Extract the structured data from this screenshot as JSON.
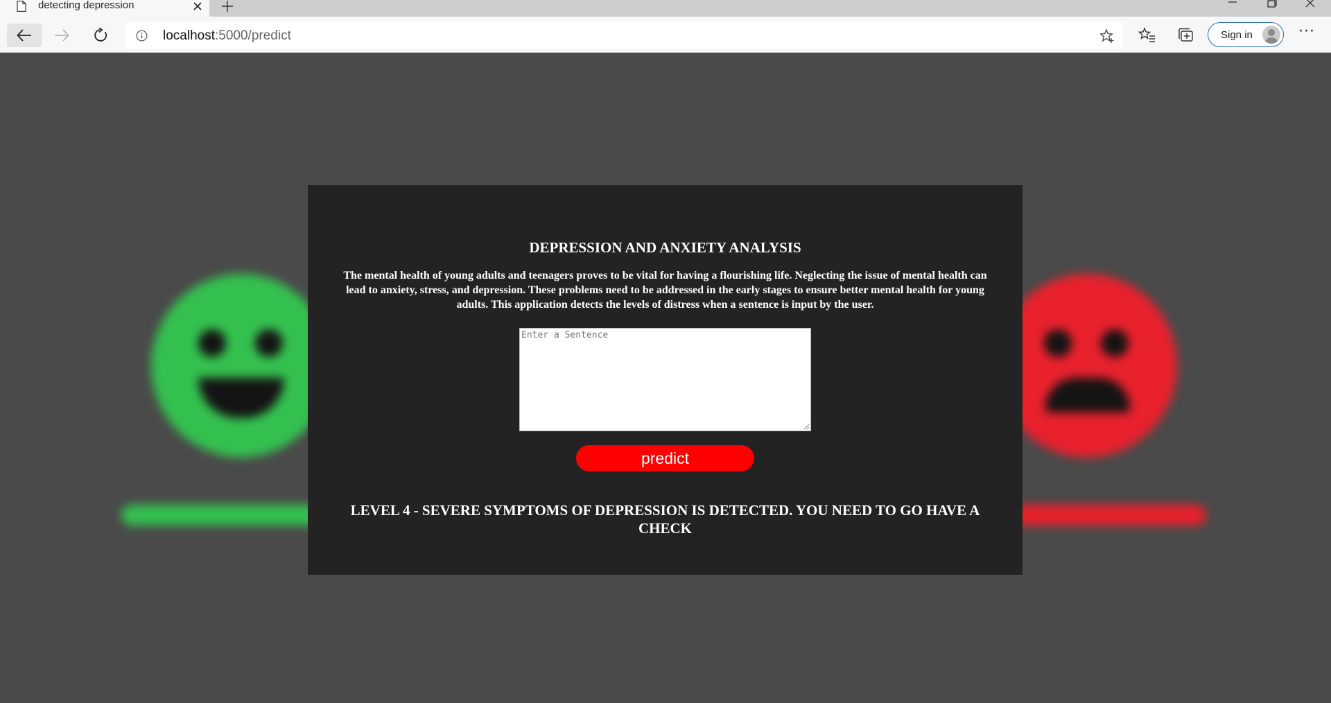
{
  "browser": {
    "tab_title": "detecting depression",
    "url_host": "localhost",
    "url_path": ":5000/predict",
    "sign_in_label": "Sign in",
    "more_label": "···"
  },
  "page": {
    "title": "DEPRESSION AND ANXIETY ANALYSIS",
    "description": "The mental health of young adults and teenagers proves to be vital for having a flourishing life. Neglecting the issue of mental health can lead to anxiety, stress, and depression. These problems need to be addressed in the early stages to ensure better mental health for young adults. This application detects the levels of distress when a sentence is input by the user.",
    "input_placeholder": "Enter a Sentence",
    "input_value": "",
    "predict_label": "predict",
    "result": "LEVEL 4 - SEVERE SYMPTOMS OF DEPRESSION IS DETECTED. YOU NEED TO GO HAVE A CHECK"
  },
  "colors": {
    "accent": "#ff0000",
    "card": "#232323",
    "page_bg": "#4a4a4a",
    "face_green": "#34c04f",
    "face_olive": "#4e7a35",
    "face_amber": "#a27a1c",
    "face_rust": "#8a2e14",
    "face_red": "#e8212d"
  }
}
